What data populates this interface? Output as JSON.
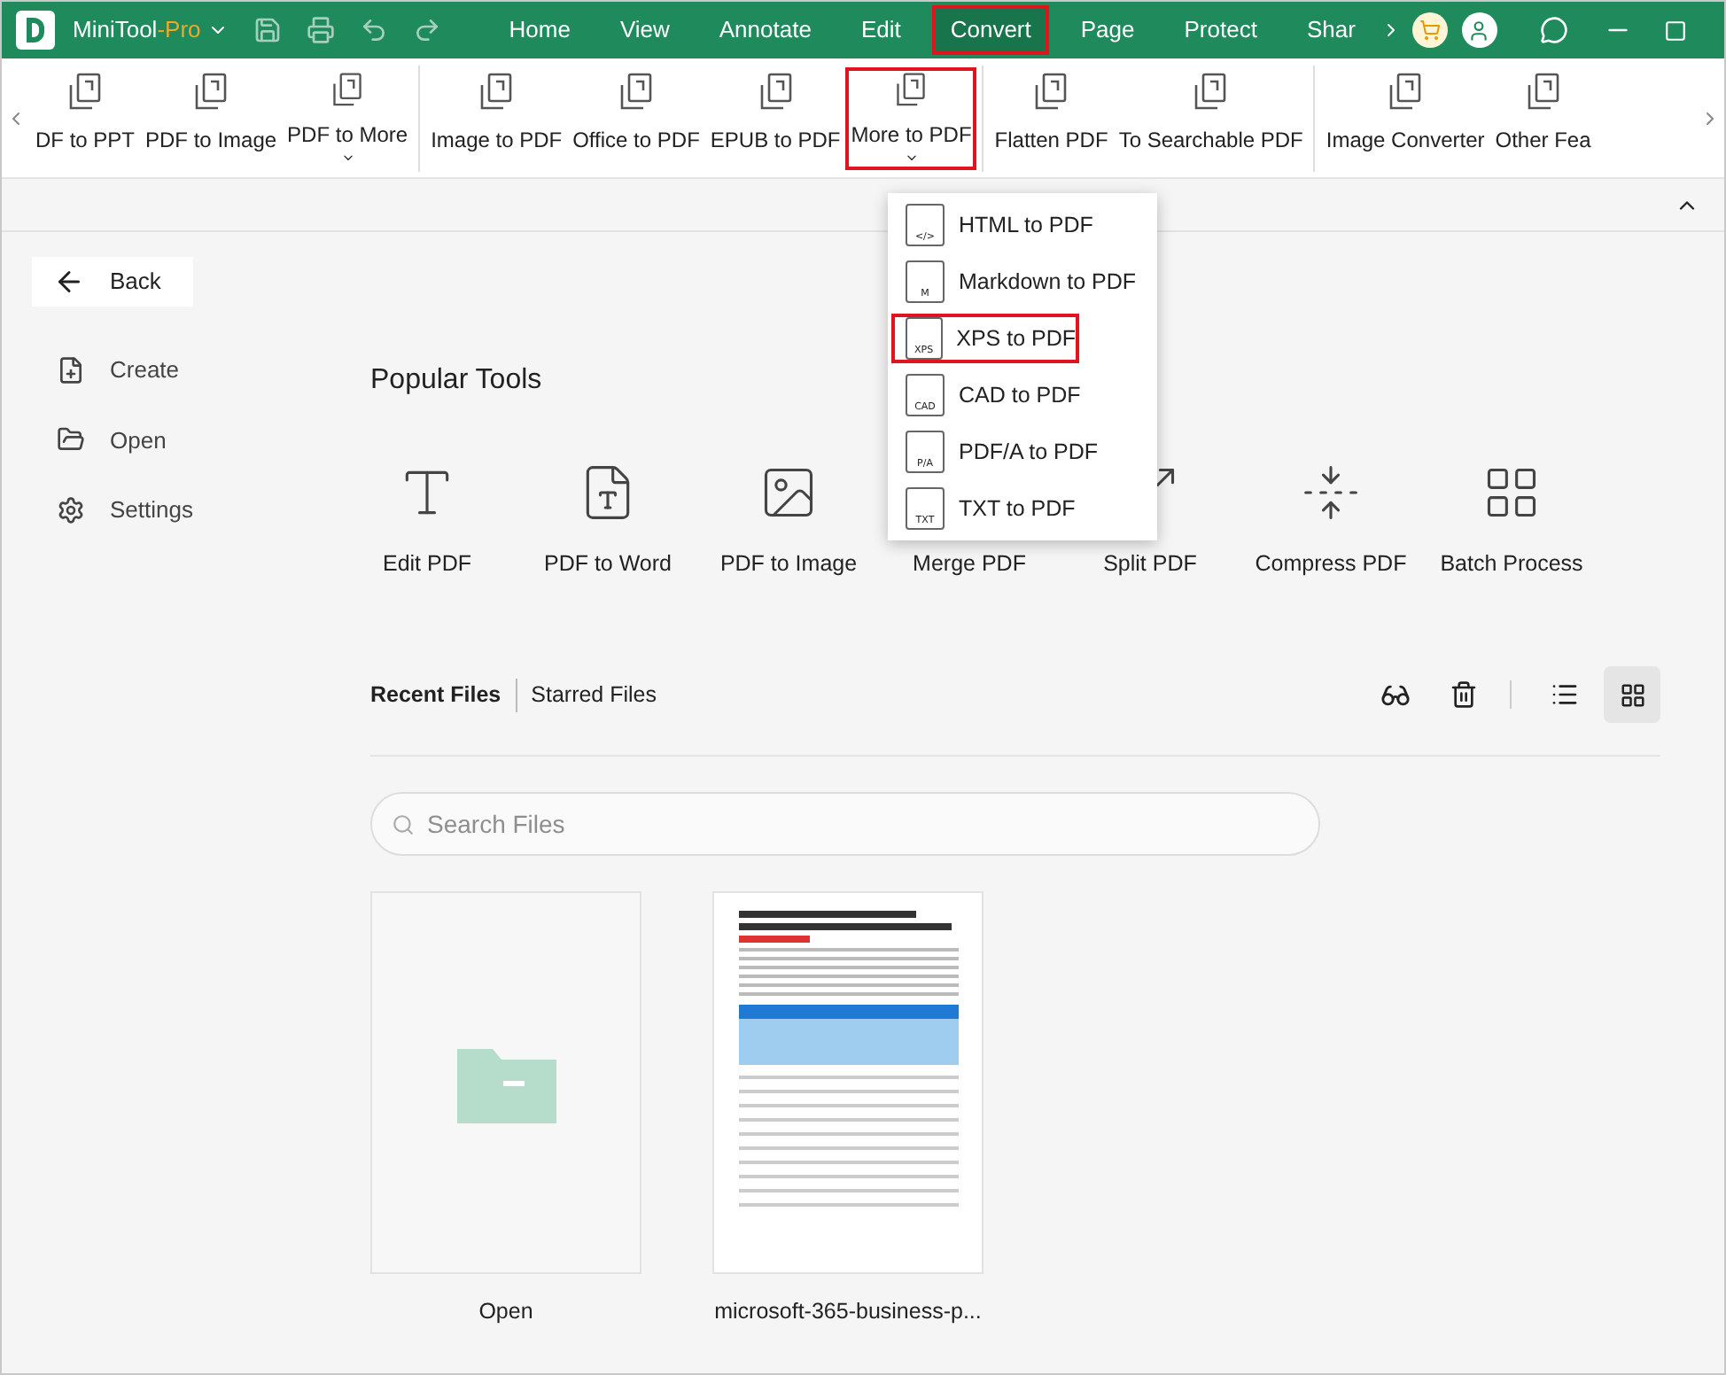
{
  "app": {
    "name": "MiniTool",
    "edition": "-Pro"
  },
  "menu_tabs": [
    {
      "label": "Home",
      "selected": false,
      "highlighted": false
    },
    {
      "label": "View",
      "selected": false,
      "highlighted": false
    },
    {
      "label": "Annotate",
      "selected": false,
      "highlighted": false
    },
    {
      "label": "Edit",
      "selected": false,
      "highlighted": false
    },
    {
      "label": "Convert",
      "selected": true,
      "highlighted": true
    },
    {
      "label": "Page",
      "selected": false,
      "highlighted": false
    },
    {
      "label": "Protect",
      "selected": false,
      "highlighted": false
    },
    {
      "label": "Shar",
      "selected": false,
      "highlighted": false
    }
  ],
  "ribbon_groups": [
    [
      {
        "label": "DF to PPT",
        "dropdown": false,
        "highlighted": false
      },
      {
        "label": "PDF to Image",
        "dropdown": false,
        "highlighted": false
      },
      {
        "label": "PDF to More",
        "dropdown": true,
        "highlighted": false
      }
    ],
    [
      {
        "label": "Image to PDF",
        "dropdown": false,
        "highlighted": false
      },
      {
        "label": "Office to PDF",
        "dropdown": false,
        "highlighted": false
      },
      {
        "label": "EPUB to PDF",
        "dropdown": false,
        "highlighted": false
      },
      {
        "label": "More to PDF",
        "dropdown": true,
        "highlighted": true
      }
    ],
    [
      {
        "label": "Flatten PDF",
        "dropdown": false,
        "highlighted": false
      },
      {
        "label": "To Searchable PDF",
        "dropdown": false,
        "highlighted": false
      }
    ],
    [
      {
        "label": "Image Converter",
        "dropdown": false,
        "highlighted": false
      },
      {
        "label": "Other Fea",
        "dropdown": false,
        "highlighted": false
      }
    ]
  ],
  "dropdown_menu": [
    {
      "label": "HTML to PDF",
      "badge": "</>",
      "highlighted": false
    },
    {
      "label": "Markdown to PDF",
      "badge": "M",
      "highlighted": false
    },
    {
      "label": "XPS to PDF",
      "badge": "XPS",
      "highlighted": true
    },
    {
      "label": "CAD to PDF",
      "badge": "CAD",
      "highlighted": false
    },
    {
      "label": "PDF/A to PDF",
      "badge": "P/A",
      "highlighted": false
    },
    {
      "label": "TXT to PDF",
      "badge": "TXT",
      "highlighted": false
    }
  ],
  "sidebar": {
    "back": "Back",
    "items": [
      {
        "kind": "create",
        "label": "Create"
      },
      {
        "kind": "open",
        "label": "Open"
      },
      {
        "kind": "settings",
        "label": "Settings"
      }
    ]
  },
  "popular_tools": {
    "title": "Popular Tools",
    "items": [
      {
        "kind": "edit",
        "label": "Edit PDF"
      },
      {
        "kind": "word",
        "label": "PDF to Word"
      },
      {
        "kind": "image",
        "label": "PDF to Image"
      },
      {
        "kind": "merge",
        "label": "Merge PDF"
      },
      {
        "kind": "split",
        "label": "Split PDF"
      },
      {
        "kind": "compress",
        "label": "Compress PDF"
      },
      {
        "kind": "batch",
        "label": "Batch Process"
      }
    ]
  },
  "file_tabs": [
    {
      "label": "Recent Files",
      "selected": true
    },
    {
      "label": "Starred Files",
      "selected": false
    }
  ],
  "view_buttons": [
    {
      "kind": "list",
      "selected": false
    },
    {
      "kind": "grid",
      "selected": true
    }
  ],
  "search": {
    "placeholder": "Search Files"
  },
  "cards": [
    {
      "kind": "open",
      "label": "Open"
    },
    {
      "kind": "file",
      "label": "microsoft-365-business-p..."
    }
  ]
}
